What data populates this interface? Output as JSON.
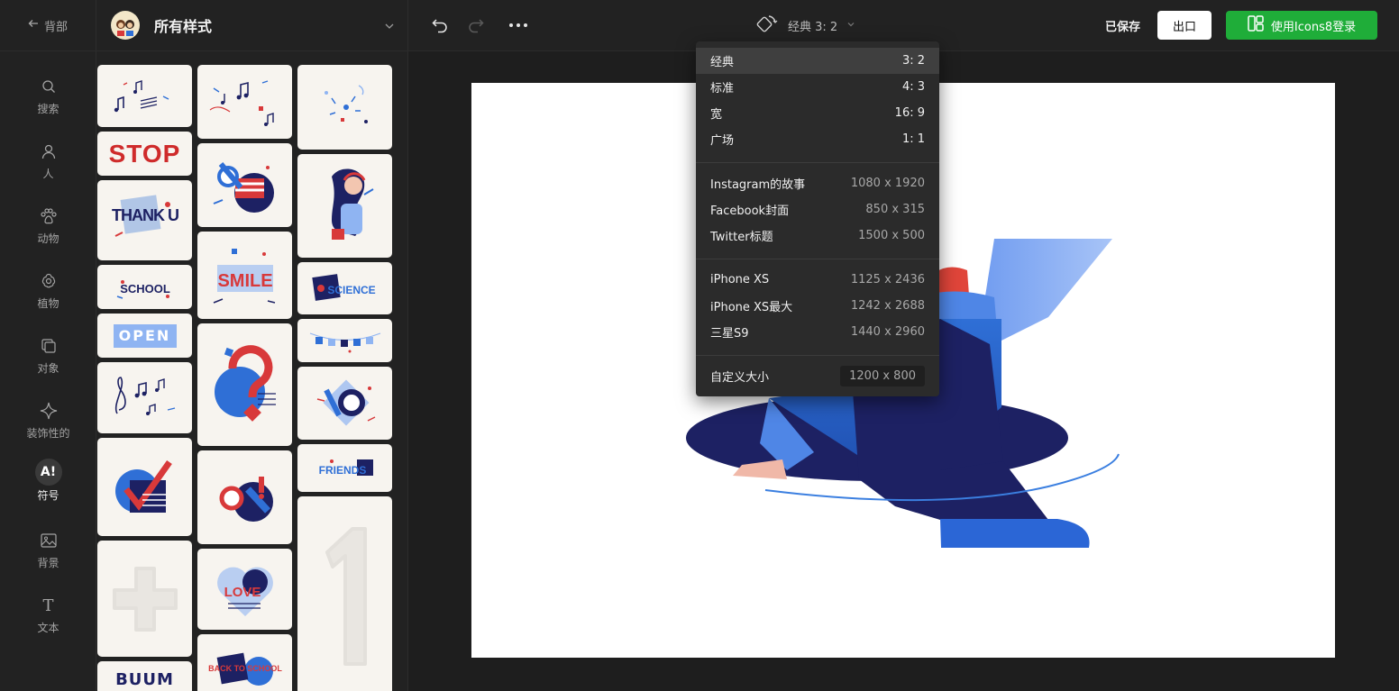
{
  "topbar": {
    "back_label": "背部",
    "style_title": "所有样式",
    "ratio_label": "经典 3: 2",
    "saved_label": "已保存",
    "export_label": "出口",
    "login_label": "使用Icons8登录"
  },
  "nav": {
    "items": [
      {
        "label": "搜索",
        "icon": "search-icon"
      },
      {
        "label": "人",
        "icon": "person-icon"
      },
      {
        "label": "动物",
        "icon": "paw-icon"
      },
      {
        "label": "植物",
        "icon": "flower-icon"
      },
      {
        "label": "对象",
        "icon": "object-icon"
      },
      {
        "label": "装饰性的",
        "icon": "sparkle-icon"
      },
      {
        "label": "符号",
        "icon": "symbol-icon",
        "active": true
      },
      {
        "label": "背景",
        "icon": "image-icon"
      },
      {
        "label": "文本",
        "icon": "text-icon"
      }
    ],
    "symbol_glyph": "A!",
    "text_glyph": "T"
  },
  "stickers": {
    "stop_text": "STOP",
    "thank_text": "THANK U",
    "school_text": "SCHOOL",
    "open_text": "OPEN",
    "smile_text": "SMILE",
    "science_text": "SCIENCE",
    "friends_text": "FRIENDS",
    "ok_text": "OK",
    "love_text": "LOVE",
    "school2_text": "BACK TO SCHOOL",
    "buum_text": "BUUM"
  },
  "dropdown": {
    "group1": [
      {
        "name": "经典",
        "value": "3: 2",
        "selected": true
      },
      {
        "name": "标准",
        "value": "4: 3"
      },
      {
        "name": "宽",
        "value": "16: 9"
      },
      {
        "name": "广场",
        "value": "1: 1"
      }
    ],
    "group2": [
      {
        "name": "Instagram的故事",
        "value": "1080 x 1920"
      },
      {
        "name": "Facebook封面",
        "value": "850 x 315"
      },
      {
        "name": "Twitter标题",
        "value": "1500 x 500"
      }
    ],
    "group3": [
      {
        "name": "iPhone XS",
        "value": "1125 x 2436"
      },
      {
        "name": "iPhone XS最大",
        "value": "1242 x 2688"
      },
      {
        "name": "三星S9",
        "value": "1440 x 2960"
      }
    ],
    "custom": {
      "name": "自定义大小",
      "value": "1200 x 800"
    }
  },
  "colors": {
    "accent_green": "#1fad39",
    "navy": "#1d2163",
    "blue": "#2f6fd6",
    "red": "#d8393a"
  }
}
